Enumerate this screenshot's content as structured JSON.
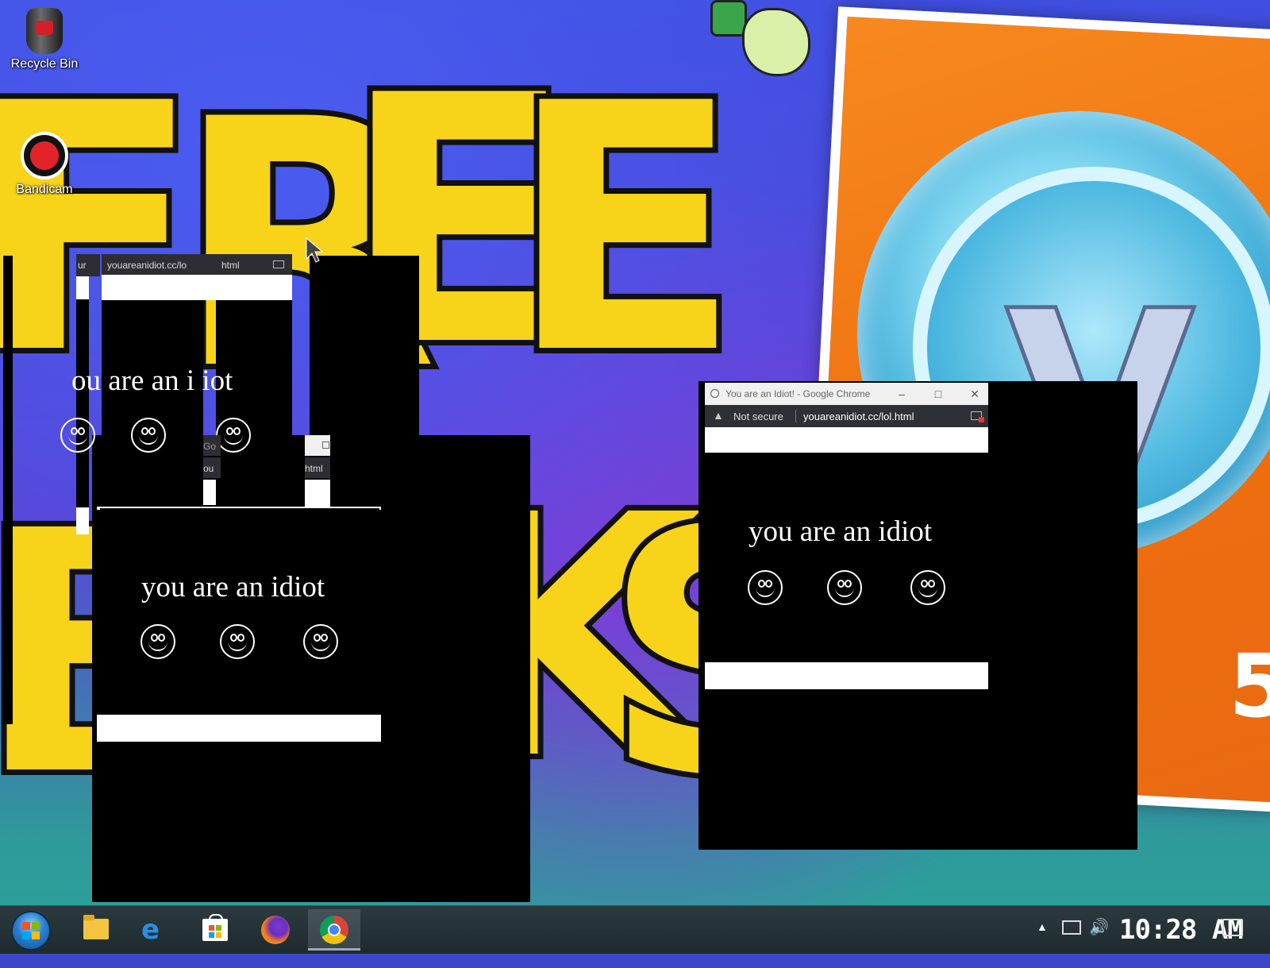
{
  "desktop": {
    "icons": [
      {
        "label": "Recycle Bin",
        "icon": "recycle-bin-icon"
      },
      {
        "label": "Bandicam",
        "icon": "bandicam-icon"
      }
    ]
  },
  "idiot_window": {
    "title": "You are an Idiot! - Google Chrome",
    "security_label": "Not secure",
    "url": "youareanidiot.cc/lol.html",
    "message": "you are an idiot",
    "smiley_count": 3
  },
  "ghost_windows": {
    "url_fragment": "youareanidiot.cc/lo",
    "url_tail": "html",
    "partial_message_1": "ou  are an i  iot",
    "url_fragment_small": "ou",
    "url_tail_small": "html",
    "title_fragment": "Go",
    "left_url_fragment": "ur"
  },
  "taskbar": {
    "pinned": [
      {
        "name": "file-explorer",
        "icon": "folder-icon"
      },
      {
        "name": "edge",
        "icon": "edge-icon"
      },
      {
        "name": "store",
        "icon": "store-icon"
      },
      {
        "name": "firefox",
        "icon": "firefox-icon"
      },
      {
        "name": "chrome",
        "icon": "chrome-icon",
        "active": true
      }
    ],
    "clock": "10:28 AM"
  },
  "colors": {
    "wallpaper_blue": "#3f4fe0",
    "taskbar": "#1d2a2e",
    "idiot_bg": "#000000",
    "idiot_text": "#ffffff"
  }
}
